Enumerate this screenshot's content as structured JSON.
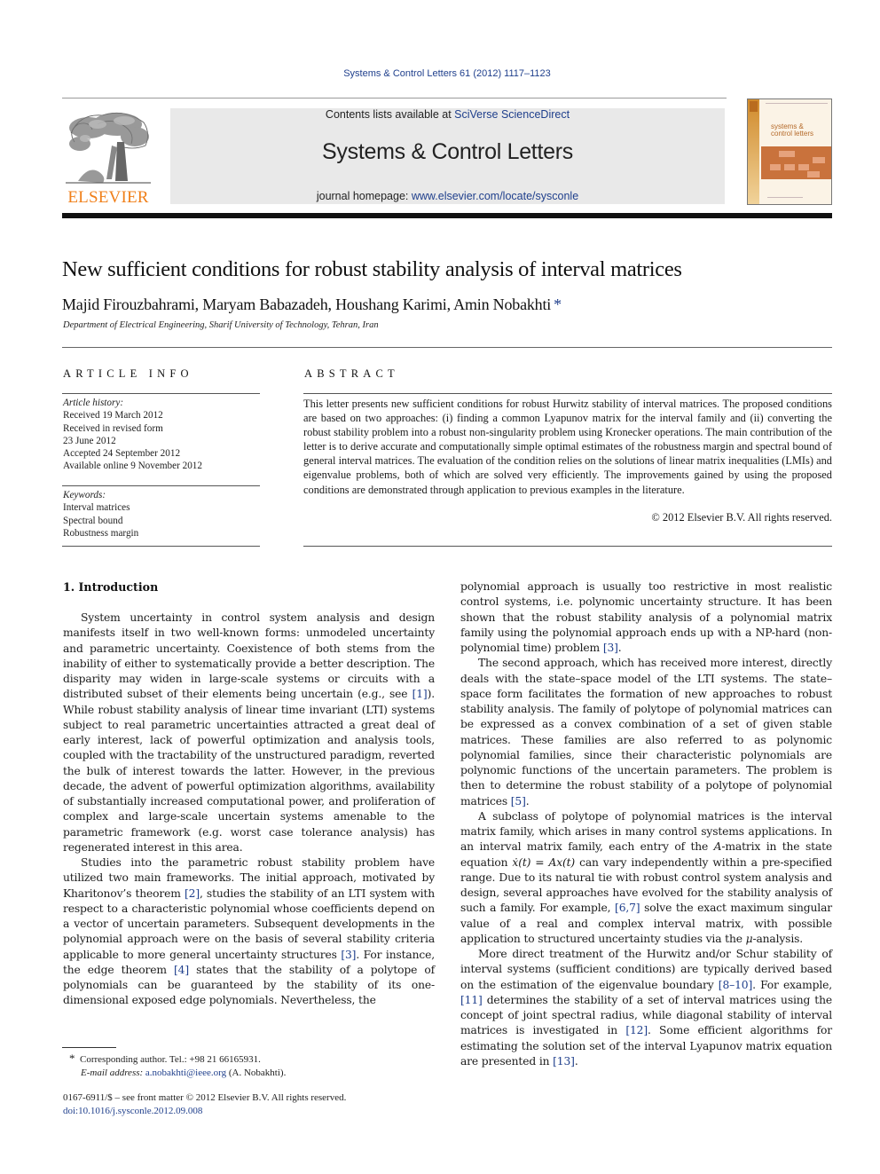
{
  "journal": {
    "running_head": "Systems & Control Letters 61 (2012) 1117–1123",
    "contents_prefix": "Contents lists available at ",
    "contents_link": "SciVerse ScienceDirect",
    "title": "Systems & Control Letters",
    "homepage_prefix": "journal homepage: ",
    "homepage_link": "www.elsevier.com/locate/sysconle",
    "publisher_logo_text": "ELSEVIER",
    "cover_title_line1": "systems &",
    "cover_title_line2": "control letters",
    "colors": {
      "link": "#1f3f8c",
      "elsevier_orange": "#f07f19",
      "banner_bg": "#e9e9e9",
      "cover_accent": "#c9723c"
    }
  },
  "article": {
    "title": "New sufficient conditions for robust stability analysis of interval matrices",
    "authors": "Majid Firouzbahrami, Maryam Babazadeh, Houshang Karimi, Amin Nobakhti",
    "corresponding_marker": "*",
    "affiliation": "Department of Electrical Engineering, Sharif University of Technology, Tehran, Iran"
  },
  "article_info": {
    "heading": "ARTICLE INFO",
    "history_label": "Article history:",
    "history": [
      "Received 19 March 2012",
      "Received in revised form",
      "23 June 2012",
      "Accepted 24 September 2012",
      "Available online 9 November 2012"
    ],
    "keywords_label": "Keywords:",
    "keywords": [
      "Interval matrices",
      "Spectral bound",
      "Robustness margin"
    ]
  },
  "abstract": {
    "heading": "ABSTRACT",
    "text": "This letter presents new sufficient conditions for robust Hurwitz stability of interval matrices. The proposed conditions are based on two approaches: (i) finding a common Lyapunov matrix for the interval family and (ii) converting the robust stability problem into a robust non-singularity problem using Kronecker operations. The main contribution of the letter is to derive accurate and computationally simple optimal estimates of the robustness margin and spectral bound of general interval matrices. The evaluation of the condition relies on the solutions of linear matrix inequalities (LMIs) and eigenvalue problems, both of which are solved very efficiently. The improvements gained by using the proposed conditions are demonstrated through application to previous examples in the literature.",
    "copyright": "© 2012 Elsevier B.V. All rights reserved."
  },
  "body": {
    "section_title": "1.  Introduction",
    "left": {
      "p1_a": "System uncertainty in control system analysis and design manifests itself in two well-known forms: unmodeled uncertainty and parametric uncertainty. Coexistence of both stems from the inability of either to systematically provide a better description. The disparity may widen in large-scale systems or circuits with a distributed subset of their elements being uncertain (e.g., see ",
      "p1_ref1": "[1]",
      "p1_b": "). While robust stability analysis of linear time invariant (LTI) systems subject to real parametric uncertainties attracted a great deal of early interest, lack of powerful optimization and analysis tools, coupled with the tractability of the unstructured paradigm, reverted the bulk of interest towards the latter. However, in the previous decade, the advent of powerful optimization algorithms, availability of substantially increased computational power, and proliferation of complex and large-scale uncertain systems amenable to the parametric framework (e.g. worst case tolerance analysis) has regenerated interest in this area.",
      "p2_a": "Studies into the parametric robust stability problem have utilized two main frameworks. The initial approach, motivated by Kharitonov’s theorem ",
      "p2_ref2": "[2]",
      "p2_b": ", studies the stability of an LTI system with respect to a characteristic polynomial whose coefficients depend on a vector of uncertain parameters. Subsequent developments in the polynomial approach were on the basis of several stability criteria applicable to more general uncertainty structures ",
      "p2_ref3": "[3]",
      "p2_c": ". For instance, the edge theorem ",
      "p2_ref4": "[4]",
      "p2_d": " states that the stability of a polytope of polynomials can be guaranteed by the stability of its one-dimensional exposed edge polynomials. Nevertheless, the"
    },
    "right": {
      "p0_a": "polynomial approach is usually too restrictive in most realistic control systems, i.e. polynomic uncertainty structure. It has been shown that the robust stability analysis of a polynomial matrix family using the polynomial approach ends up with a NP-hard (non-polynomial time) problem ",
      "p0_ref3": "[3]",
      "p0_b": ".",
      "p1_a": "The second approach, which has received more interest, directly deals with the state–space model of the LTI systems. The state–space form facilitates the formation of new approaches to robust stability analysis. The family of polytope of polynomial matrices can be expressed as a convex combination of a set of given stable matrices. These families are also referred to as polynomic polynomial families, since their characteristic polynomials are polynomic functions of the uncertain parameters. The problem is then to determine the robust stability of a polytope of polynomial matrices ",
      "p1_ref5": "[5]",
      "p1_b": ".",
      "p2_a": "A subclass of polytope of polynomial matrices is the interval matrix family, which arises in many control systems applications. In an interval matrix family, each entry of the ",
      "p2_A": "A",
      "p2_b": "-matrix in the state equation ",
      "p2_eq": "ẋ(t)  =  Ax(t)",
      "p2_c": " can vary independently within a pre-specified range. Due to its natural tie with robust control system analysis and design, several approaches have evolved for the stability analysis of such a family. For example, ",
      "p2_ref67": "[6,7]",
      "p2_d": " solve the exact maximum singular value of a real and complex interval matrix, with possible application to structured uncertainty studies via the ",
      "p2_mu": "μ",
      "p2_e": "-analysis.",
      "p3_a": "More direct treatment of the Hurwitz and/or Schur stability of interval systems (sufficient conditions) are typically derived based on the estimation of the eigenvalue boundary ",
      "p3_ref810": "[8–10]",
      "p3_b": ". For example, ",
      "p3_ref11": "[11]",
      "p3_c": " determines the stability of a set of interval matrices using the concept of joint spectral radius, while diagonal stability of interval matrices is investigated in ",
      "p3_ref12": "[12]",
      "p3_d": ". Some efficient algorithms for estimating the solution set of the interval Lyapunov matrix equation are presented in ",
      "p3_ref13": "[13]",
      "p3_e": "."
    }
  },
  "footnotes": {
    "marker": "*",
    "corresponding": "Corresponding author. Tel.: +98 21 66165931.",
    "email_label": "E-mail address:",
    "email": "a.nobakhti@ieee.org",
    "email_suffix": " (A. Nobakhti).",
    "front_matter": "0167-6911/$ – see front matter © 2012 Elsevier B.V. All rights reserved.",
    "doi": "doi:10.1016/j.sysconle.2012.09.008"
  }
}
